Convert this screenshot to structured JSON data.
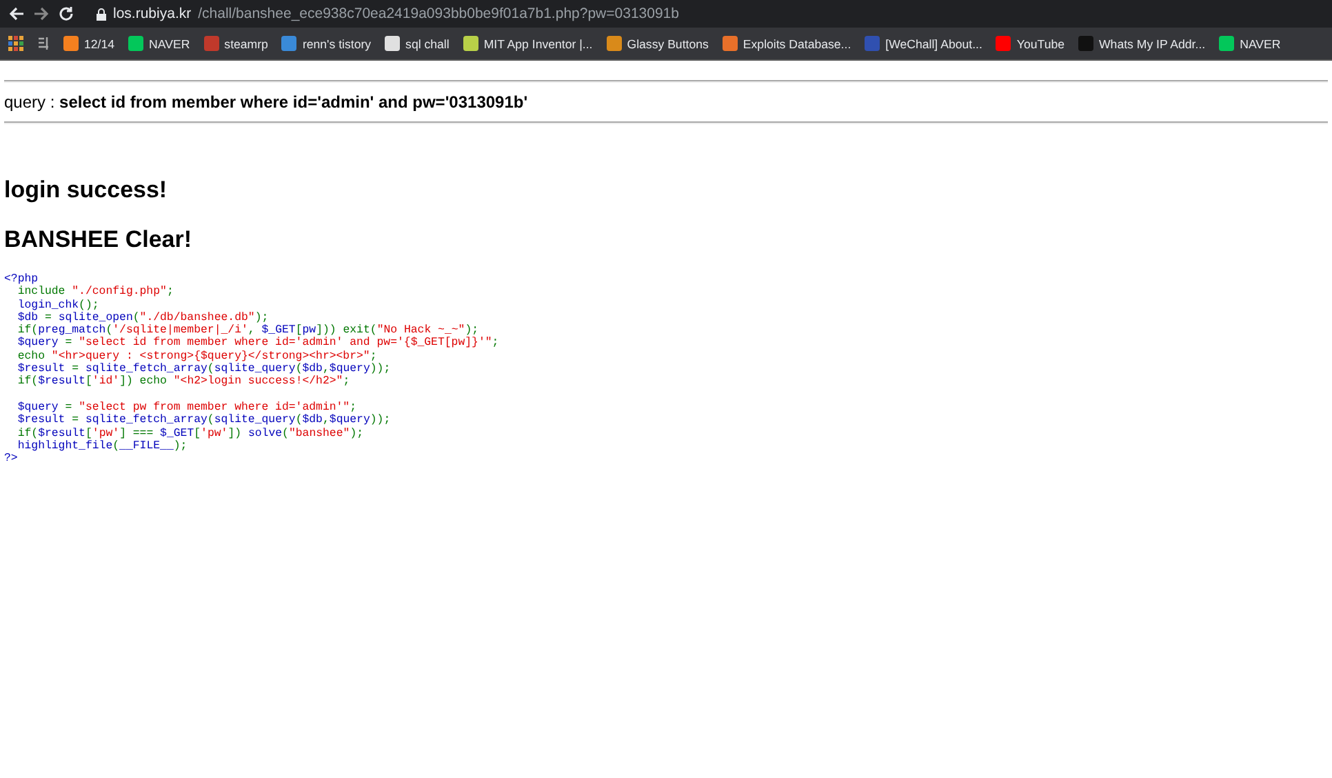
{
  "browser": {
    "url_host": "los.rubiya.kr",
    "url_path": "/chall/banshee_ece938c70ea2419a093bb0be9f01a7b1.php?pw=0313091b",
    "bookmarks": [
      {
        "label": "12/14",
        "color": "#f4801f"
      },
      {
        "label": "NAVER",
        "color": "#03c75a"
      },
      {
        "label": "steamrp",
        "color": "#c0392b"
      },
      {
        "label": "renn's tistory",
        "color": "#3a8ad8"
      },
      {
        "label": "sql chall",
        "color": "#e0e0e0"
      },
      {
        "label": "MIT App Inventor |...",
        "color": "#b8d048"
      },
      {
        "label": "Glassy Buttons",
        "color": "#d98a1a"
      },
      {
        "label": "Exploits Database...",
        "color": "#e8702a"
      },
      {
        "label": "[WeChall] About...",
        "color": "#3050b0"
      },
      {
        "label": "YouTube",
        "color": "#ff0000"
      },
      {
        "label": "Whats My IP Addr...",
        "color": "#111111"
      },
      {
        "label": "NAVER",
        "color": "#03c75a"
      }
    ]
  },
  "page": {
    "query": "query : **select id from member where id='admin' and pw='0313091b'**",
    "headings": [
      "login success!",
      "BANSHEE Clear!"
    ],
    "code_lines": [
      {
        "kind": "code",
        "tokens": [
          {
            "text": "<?php",
            "kind": "default"
          }
        ]
      },
      {
        "kind": "code",
        "tokens": [
          {
            "text": "  include ",
            "kind": "keyword"
          },
          {
            "text": "\"./config.php\"",
            "kind": "string"
          },
          {
            "text": ";",
            "kind": "keyword"
          }
        ]
      },
      {
        "kind": "code",
        "tokens": [
          {
            "text": "  login_chk",
            "kind": "default"
          },
          {
            "text": "();",
            "kind": "keyword"
          }
        ]
      },
      {
        "kind": "code",
        "tokens": [
          {
            "text": "  $db ",
            "kind": "default"
          },
          {
            "text": "= ",
            "kind": "keyword"
          },
          {
            "text": "sqlite_open",
            "kind": "default"
          },
          {
            "text": "(",
            "kind": "keyword"
          },
          {
            "text": "\"./db/banshee.db\"",
            "kind": "string"
          },
          {
            "text": ");",
            "kind": "keyword"
          }
        ]
      },
      {
        "kind": "code",
        "tokens": [
          {
            "text": "  if(",
            "kind": "keyword"
          },
          {
            "text": "preg_match",
            "kind": "default"
          },
          {
            "text": "(",
            "kind": "keyword"
          },
          {
            "text": "'/sqlite|member|_/i'",
            "kind": "string"
          },
          {
            "text": ", ",
            "kind": "keyword"
          },
          {
            "text": "$_GET",
            "kind": "default"
          },
          {
            "text": "[",
            "kind": "keyword"
          },
          {
            "text": "pw",
            "kind": "default"
          },
          {
            "text": "])) exit(",
            "kind": "keyword"
          },
          {
            "text": "\"No Hack ~_~\"",
            "kind": "string"
          },
          {
            "text": ");",
            "kind": "keyword"
          }
        ]
      },
      {
        "kind": "code",
        "tokens": [
          {
            "text": "  $query ",
            "kind": "default"
          },
          {
            "text": "= ",
            "kind": "keyword"
          },
          {
            "text": "\"select id from member where id='admin' and pw='{$_GET[pw]}'\"",
            "kind": "string"
          },
          {
            "text": ";",
            "kind": "keyword"
          }
        ]
      },
      {
        "kind": "code",
        "tokens": [
          {
            "text": "  echo ",
            "kind": "keyword"
          },
          {
            "text": "\"<hr>query : <strong>{$query}</strong><hr><br>\"",
            "kind": "string"
          },
          {
            "text": ";",
            "kind": "keyword"
          }
        ]
      },
      {
        "kind": "code",
        "tokens": [
          {
            "text": "  $result ",
            "kind": "default"
          },
          {
            "text": "= ",
            "kind": "keyword"
          },
          {
            "text": "sqlite_fetch_array",
            "kind": "default"
          },
          {
            "text": "(",
            "kind": "keyword"
          },
          {
            "text": "sqlite_query",
            "kind": "default"
          },
          {
            "text": "(",
            "kind": "keyword"
          },
          {
            "text": "$db",
            "kind": "default"
          },
          {
            "text": ",",
            "kind": "keyword"
          },
          {
            "text": "$query",
            "kind": "default"
          },
          {
            "text": "));",
            "kind": "keyword"
          }
        ]
      },
      {
        "kind": "code",
        "tokens": [
          {
            "text": "  if(",
            "kind": "keyword"
          },
          {
            "text": "$result",
            "kind": "default"
          },
          {
            "text": "[",
            "kind": "keyword"
          },
          {
            "text": "'id'",
            "kind": "string"
          },
          {
            "text": "]) echo ",
            "kind": "keyword"
          },
          {
            "text": "\"<h2>login success!</h2>\"",
            "kind": "string"
          },
          {
            "text": ";",
            "kind": "keyword"
          }
        ]
      },
      {
        "kind": "blank"
      },
      {
        "kind": "code",
        "tokens": [
          {
            "text": "  $query ",
            "kind": "default"
          },
          {
            "text": "= ",
            "kind": "keyword"
          },
          {
            "text": "\"select pw from member where id='admin'\"",
            "kind": "string"
          },
          {
            "text": ";",
            "kind": "keyword"
          }
        ]
      },
      {
        "kind": "code",
        "tokens": [
          {
            "text": "  $result ",
            "kind": "default"
          },
          {
            "text": "= ",
            "kind": "keyword"
          },
          {
            "text": "sqlite_fetch_array",
            "kind": "default"
          },
          {
            "text": "(",
            "kind": "keyword"
          },
          {
            "text": "sqlite_query",
            "kind": "default"
          },
          {
            "text": "(",
            "kind": "keyword"
          },
          {
            "text": "$db",
            "kind": "default"
          },
          {
            "text": ",",
            "kind": "keyword"
          },
          {
            "text": "$query",
            "kind": "default"
          },
          {
            "text": "));",
            "kind": "keyword"
          }
        ]
      },
      {
        "kind": "code",
        "tokens": [
          {
            "text": "  if(",
            "kind": "keyword"
          },
          {
            "text": "$result",
            "kind": "default"
          },
          {
            "text": "[",
            "kind": "keyword"
          },
          {
            "text": "'pw'",
            "kind": "string"
          },
          {
            "text": "] === ",
            "kind": "keyword"
          },
          {
            "text": "$_GET",
            "kind": "default"
          },
          {
            "text": "[",
            "kind": "keyword"
          },
          {
            "text": "'pw'",
            "kind": "string"
          },
          {
            "text": "]) ",
            "kind": "keyword"
          },
          {
            "text": "solve",
            "kind": "default"
          },
          {
            "text": "(",
            "kind": "keyword"
          },
          {
            "text": "\"banshee\"",
            "kind": "string"
          },
          {
            "text": ");",
            "kind": "keyword"
          }
        ]
      },
      {
        "kind": "code",
        "tokens": [
          {
            "text": "  highlight_file",
            "kind": "default"
          },
          {
            "text": "(",
            "kind": "keyword"
          },
          {
            "text": "__FILE__",
            "kind": "default"
          },
          {
            "text": ");",
            "kind": "keyword"
          }
        ]
      },
      {
        "kind": "code",
        "tokens": [
          {
            "text": "?>",
            "kind": "default"
          }
        ]
      }
    ]
  }
}
